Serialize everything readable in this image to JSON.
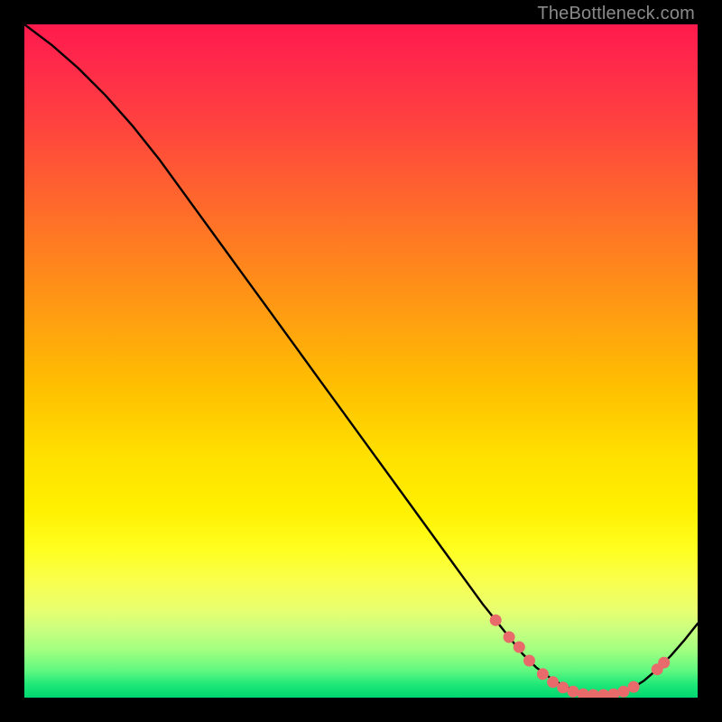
{
  "watermark": "TheBottleneck.com",
  "chart_data": {
    "type": "line",
    "title": "",
    "xlabel": "",
    "ylabel": "",
    "xlim": [
      0,
      100
    ],
    "ylim": [
      0,
      100
    ],
    "grid": false,
    "legend": false,
    "series": [
      {
        "name": "curve",
        "x": [
          0,
          4,
          8,
          12,
          16,
          20,
          24,
          28,
          32,
          36,
          40,
          44,
          48,
          52,
          56,
          60,
          64,
          68,
          70,
          72,
          74,
          76,
          78,
          80,
          82,
          84,
          86,
          88,
          90,
          92,
          94,
          96,
          98,
          100
        ],
        "y": [
          100,
          97,
          93.5,
          89.5,
          85,
          80,
          74.5,
          69,
          63.5,
          58,
          52.5,
          47,
          41.5,
          36,
          30.5,
          25,
          19.5,
          14,
          11.5,
          9,
          6.5,
          4.5,
          3,
          1.8,
          1.0,
          0.5,
          0.4,
          0.5,
          1.2,
          2.5,
          4.2,
          6.2,
          8.5,
          11
        ]
      }
    ],
    "markers": [
      {
        "x": 70,
        "y": 11.5
      },
      {
        "x": 72,
        "y": 9
      },
      {
        "x": 73.5,
        "y": 7.5
      },
      {
        "x": 75,
        "y": 5.5
      },
      {
        "x": 77,
        "y": 3.5
      },
      {
        "x": 78.5,
        "y": 2.3
      },
      {
        "x": 80,
        "y": 1.5
      },
      {
        "x": 81.5,
        "y": 0.9
      },
      {
        "x": 83,
        "y": 0.5
      },
      {
        "x": 84.5,
        "y": 0.4
      },
      {
        "x": 86,
        "y": 0.4
      },
      {
        "x": 87.5,
        "y": 0.5
      },
      {
        "x": 89,
        "y": 0.9
      },
      {
        "x": 90.5,
        "y": 1.6
      },
      {
        "x": 94,
        "y": 4.2
      },
      {
        "x": 95,
        "y": 5.2
      }
    ],
    "colors": {
      "curve_stroke": "#000000",
      "marker_fill": "#e86a6a",
      "gradient_top": "#ff1a4d",
      "gradient_mid": "#ffe000",
      "gradient_bottom": "#00d870"
    }
  }
}
